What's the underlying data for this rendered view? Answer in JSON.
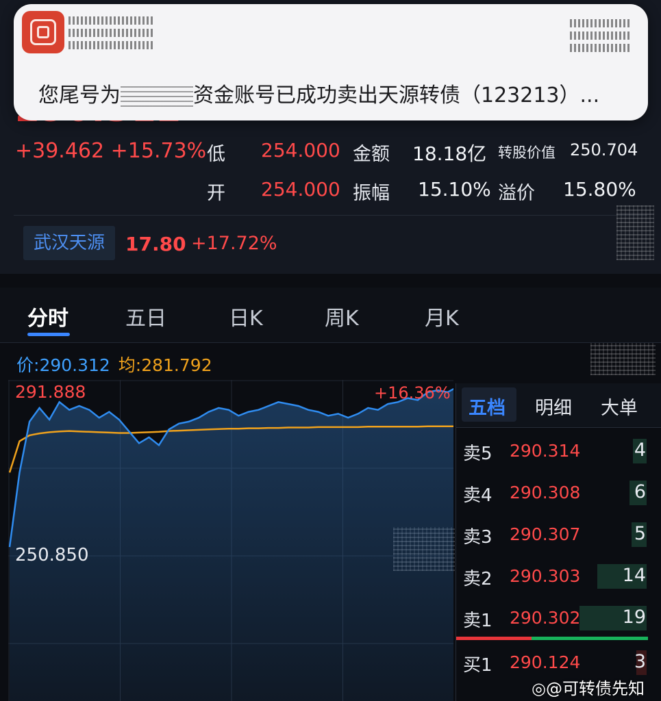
{
  "notification": {
    "text_prefix": "您尾号为",
    "text_suffix": "资金账号已成功卖出天源转债（123213）..."
  },
  "quote": {
    "price": "290.312",
    "change": "+39.462",
    "change_pct": "+15.73%",
    "low_label": "低",
    "low_value": "254.000",
    "amount_label": "金额",
    "amount_value": "18.18亿",
    "conv_value_label": "转股价值",
    "conv_value": "250.704",
    "open_label": "开",
    "open_value": "254.000",
    "amplitude_label": "振幅",
    "amplitude_value": "15.10%",
    "premium_label": "溢价",
    "premium_value": "15.80%",
    "underlying_name": "武汉天源",
    "underlying_price": "17.80",
    "underlying_pct": "+17.72%"
  },
  "tabs": [
    "分时",
    "五日",
    "日K",
    "周K",
    "月K"
  ],
  "price_avg": {
    "price_label": "价:",
    "price_value": "290.312",
    "avg_label": "均:",
    "avg_value": "281.792"
  },
  "chart_data": {
    "type": "line",
    "y_top_label": "291.888",
    "y_bottom_label": "250.850",
    "right_pct_label": "+16.36%",
    "ylim": [
      250.85,
      291.888
    ],
    "series": [
      {
        "values": [
          251.0,
          270.0,
          283.0,
          286.5,
          283.5,
          288.0,
          286.0,
          287.0,
          286.0,
          284.0,
          285.5,
          283.5,
          280.5,
          277.5,
          279.0,
          277.0,
          281.0,
          282.5,
          283.0,
          284.0,
          285.5,
          286.5,
          286.0,
          284.5,
          285.5,
          286.0,
          287.0,
          288.0,
          287.5,
          287.0,
          286.0,
          285.5,
          284.5,
          285.0,
          284.0,
          285.0,
          286.5,
          286.0,
          287.5,
          288.0,
          289.0,
          288.5,
          290.5,
          291.0,
          290.5,
          291.9,
          290.3
        ],
        "color": "#2f8cf0"
      },
      {
        "values": [
          270.0,
          278.0,
          279.5,
          280.0,
          280.3,
          280.5,
          280.6,
          280.5,
          280.4,
          280.3,
          280.2,
          280.1,
          280.1,
          280.2,
          280.3,
          280.4,
          280.6,
          280.7,
          280.8,
          280.9,
          281.0,
          281.1,
          281.2,
          281.2,
          281.3,
          281.3,
          281.4,
          281.4,
          281.5,
          281.5,
          281.5,
          281.6,
          281.6,
          281.6,
          281.6,
          281.6,
          281.7,
          281.7,
          281.7,
          281.7,
          281.7,
          281.7,
          281.8,
          281.8,
          281.8,
          281.8,
          281.8
        ],
        "color": "#f0a21c"
      }
    ]
  },
  "order_book": {
    "tabs": [
      "五档",
      "明细",
      "大单"
    ],
    "asks": [
      {
        "label": "卖5",
        "price": "290.314",
        "vol": "4",
        "bar": 0.2
      },
      {
        "label": "卖4",
        "price": "290.308",
        "vol": "6",
        "bar": 0.25
      },
      {
        "label": "卖3",
        "price": "290.307",
        "vol": "5",
        "bar": 0.22
      },
      {
        "label": "卖2",
        "price": "290.303",
        "vol": "14",
        "bar": 0.73
      },
      {
        "label": "卖1",
        "price": "290.302",
        "vol": "19",
        "bar": 1.0
      }
    ],
    "bids": [
      {
        "label": "买1",
        "price": "290.124",
        "vol": "3",
        "bar": 0.15
      }
    ]
  },
  "watermark": "@可转债先知"
}
